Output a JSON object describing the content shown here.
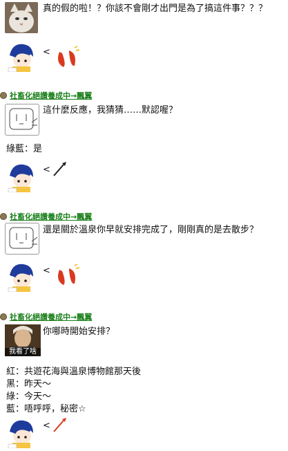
{
  "messages": {
    "m1": "真的假的啦！？你該不會剛才出門是為了搞這件事？？？",
    "m2": "這什麼反應，我猜猜……默認喔？",
    "m3": "綠藍：是",
    "m4": "還是關於溫泉你早就安排完成了，剛剛真的是去散步？",
    "m5": "你哪時開始安排？",
    "m6": "紅：共遊花海與溫泉博物館那天後",
    "m7": "黑：昨天～",
    "m8": "綠：今天～",
    "m9": "藍：唔呼呼，秘密☆"
  },
  "lt": "<",
  "user_name": "社畜化絕讚養成中→飄翼",
  "image_caption": "我看了啥",
  "colors": {
    "user": "#1a7f1a",
    "sticker_red": "#d93a1f"
  },
  "icons": [
    "cat-meme-icon",
    "chibi-avatar-icon",
    "red-sausage-sticker-icon",
    "dog-face-icon",
    "stick-sticker-icon",
    "man-portrait-icon"
  ]
}
